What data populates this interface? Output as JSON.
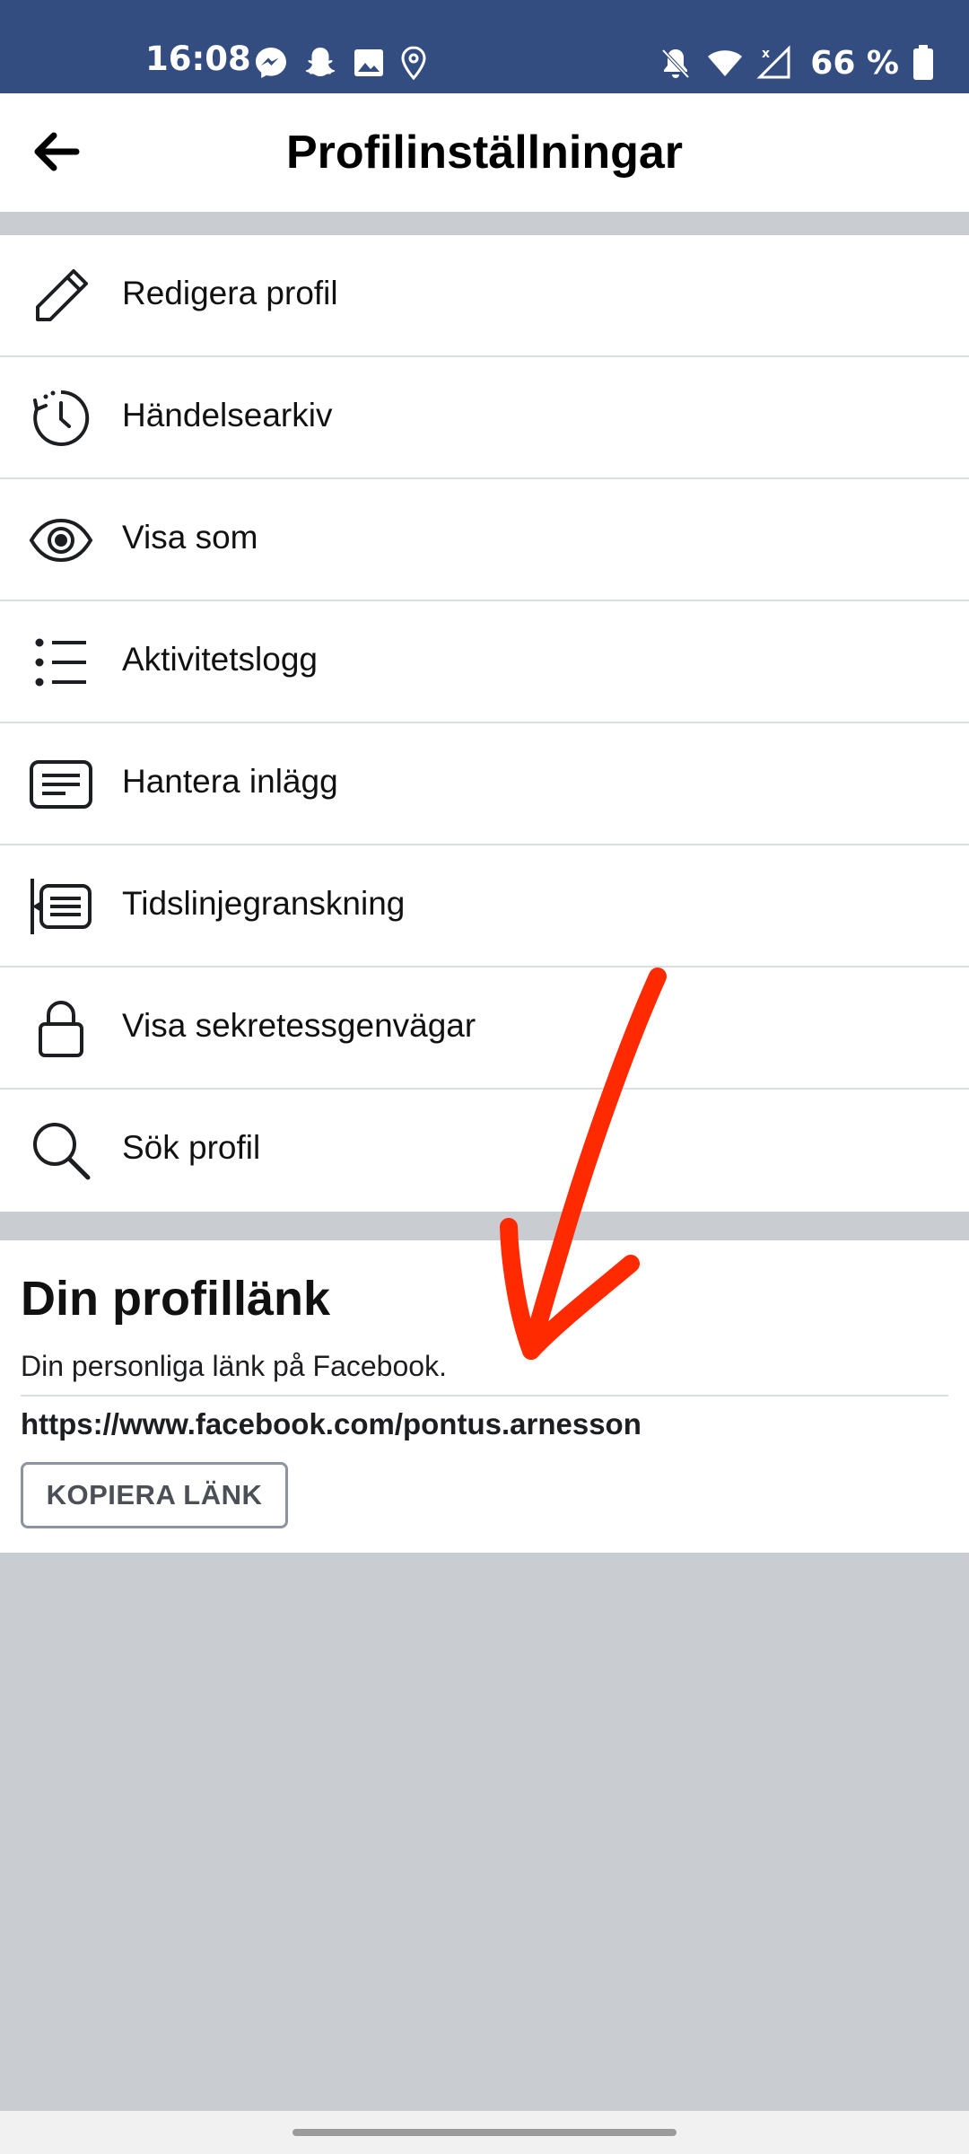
{
  "status_bar": {
    "time": "16:08",
    "battery_text": "66 %",
    "left_icons": [
      "messenger-icon",
      "snapchat-icon",
      "gallery-icon",
      "location-icon"
    ],
    "right_icons": [
      "mute-bell-icon",
      "wifi-icon",
      "signal-icon",
      "battery-icon"
    ],
    "bg_color": "#344d80"
  },
  "app_bar": {
    "title": "Profilinställningar",
    "back_icon": "arrow-left-icon"
  },
  "menu": {
    "items": [
      {
        "label": "Redigera profil",
        "icon": "pencil-icon"
      },
      {
        "label": "Händelsearkiv",
        "icon": "history-clock-icon"
      },
      {
        "label": "Visa som",
        "icon": "eye-icon"
      },
      {
        "label": "Aktivitetslogg",
        "icon": "list-icon"
      },
      {
        "label": "Hantera inlägg",
        "icon": "posts-icon"
      },
      {
        "label": "Tidslinjegranskning",
        "icon": "timeline-review-icon"
      },
      {
        "label": "Visa sekretessgenvägar",
        "icon": "lock-icon"
      },
      {
        "label": "Sök profil",
        "icon": "search-icon"
      }
    ]
  },
  "profile_link": {
    "title": "Din profillänk",
    "description": "Din personliga länk på Facebook.",
    "url": "https://www.facebook.com/pontus.arnesson",
    "copy_button": "KOPIERA LÄNK"
  },
  "colors": {
    "background": "#c9ccd1",
    "annotation_arrow": "#ff2a00",
    "divider": "#dadde1"
  }
}
